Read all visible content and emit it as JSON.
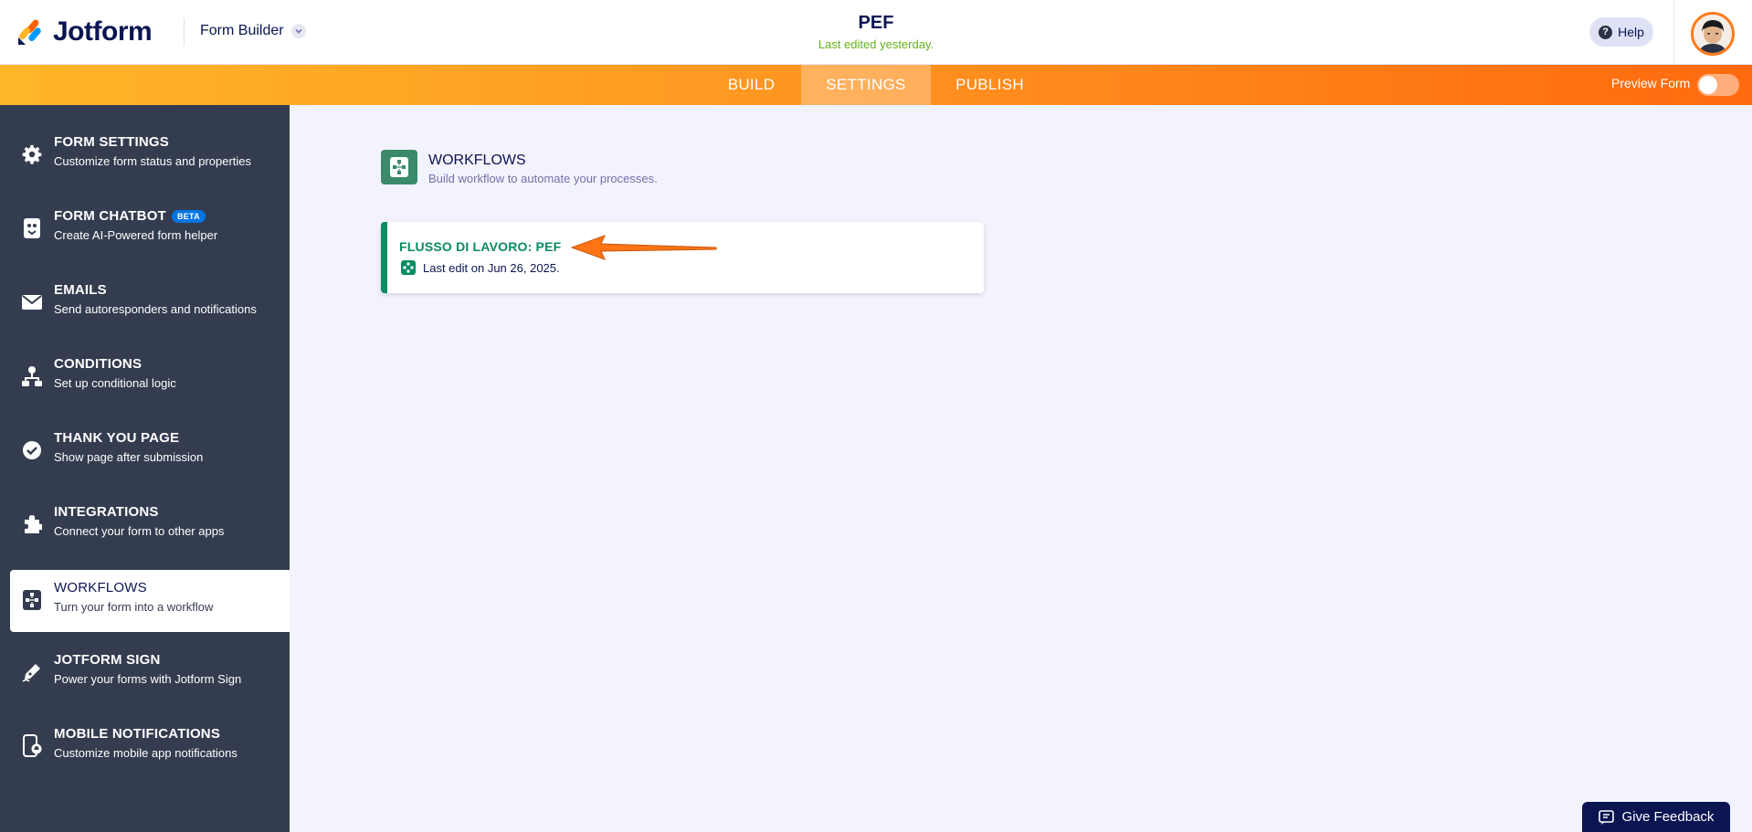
{
  "header": {
    "logo_text": "Jotform",
    "builder_label": "Form Builder",
    "form_title": "PEF",
    "form_subtitle": "Last edited yesterday.",
    "help_label": "Help"
  },
  "nav": {
    "tabs": [
      {
        "label": "BUILD"
      },
      {
        "label": "SETTINGS",
        "active": true
      },
      {
        "label": "PUBLISH"
      }
    ],
    "preview_label": "Preview Form",
    "preview_enabled": false
  },
  "sidebar": {
    "items": [
      {
        "title": "FORM SETTINGS",
        "desc": "Customize form status and properties",
        "icon": "gear-icon"
      },
      {
        "title": "FORM CHATBOT",
        "badge": "BETA",
        "desc": "Create AI-Powered form helper",
        "icon": "chatbot-icon"
      },
      {
        "title": "EMAILS",
        "desc": "Send autoresponders and notifications",
        "icon": "envelope-icon"
      },
      {
        "title": "CONDITIONS",
        "desc": "Set up conditional logic",
        "icon": "hierarchy-icon"
      },
      {
        "title": "THANK YOU PAGE",
        "desc": "Show page after submission",
        "icon": "check-circle-icon"
      },
      {
        "title": "INTEGRATIONS",
        "desc": "Connect your form to other apps",
        "icon": "puzzle-icon"
      },
      {
        "title": "WORKFLOWS",
        "desc": "Turn your form into a workflow",
        "icon": "workflow-icon",
        "active": true
      },
      {
        "title": "JOTFORM SIGN",
        "desc": "Power your forms with Jotform Sign",
        "icon": "pen-icon"
      },
      {
        "title": "MOBILE NOTIFICATIONS",
        "desc": "Customize mobile app notifications",
        "icon": "mobile-bell-icon"
      }
    ]
  },
  "main": {
    "section_title": "WORKFLOWS",
    "section_desc": "Build workflow to automate your processes.",
    "workflow_card": {
      "title": "FLUSSO DI LAVORO: PEF",
      "meta": "Last edit on Jun 26, 2025."
    }
  },
  "feedback_label": "Give Feedback",
  "colors": {
    "brand_navy": "#0a1551",
    "accent_orange": "#ff6a10",
    "sidebar_bg": "#343c4f",
    "workflow_green": "#078c65",
    "status_green": "#64b21c"
  }
}
